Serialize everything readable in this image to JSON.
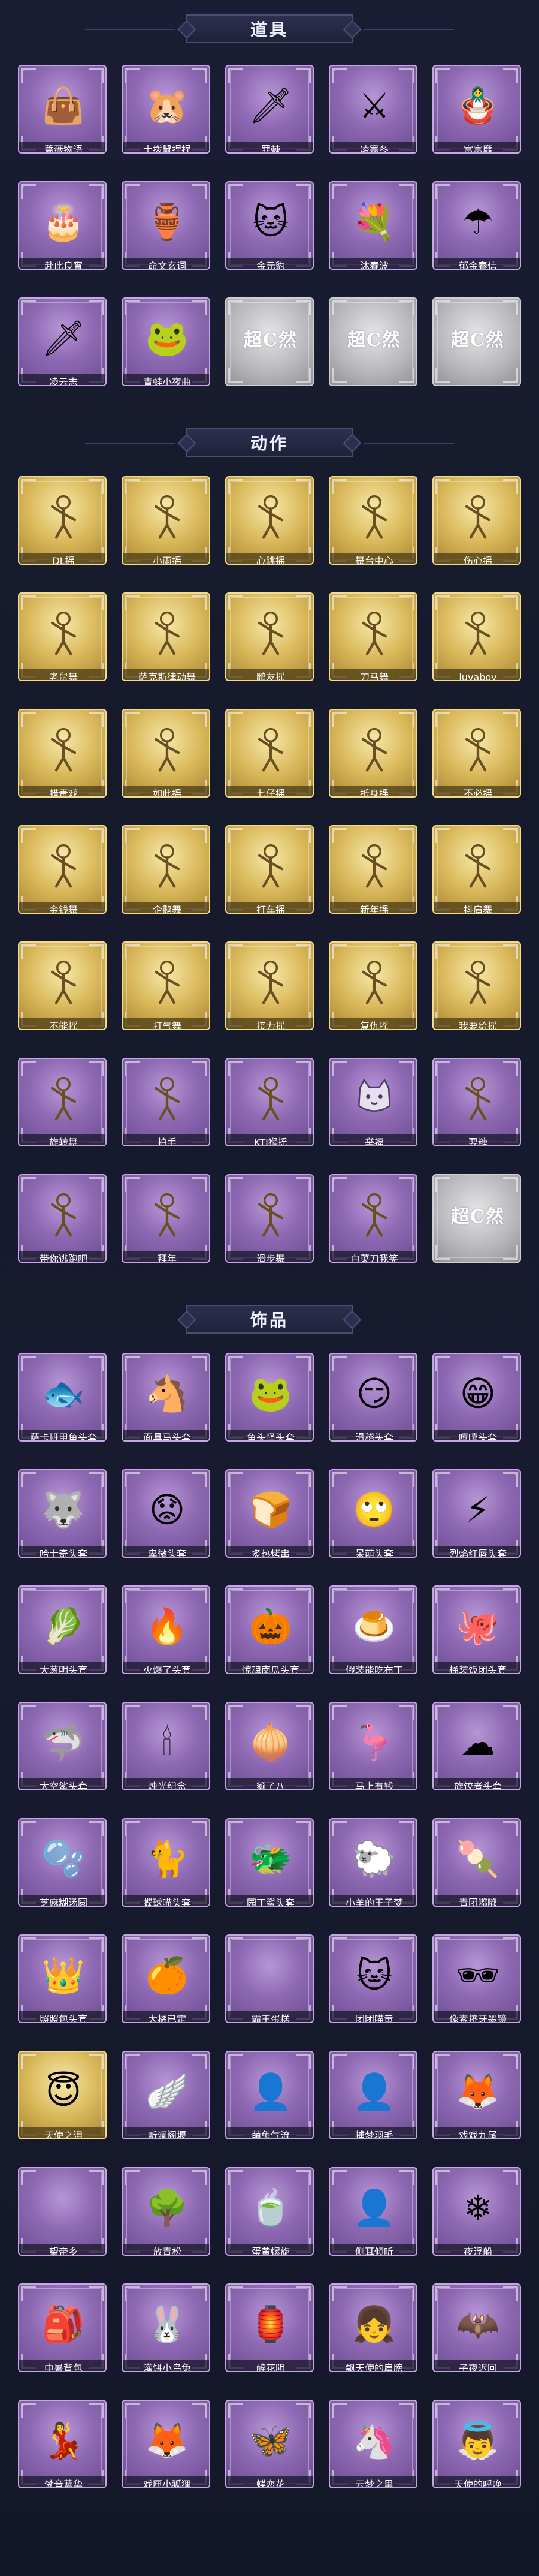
{
  "sections": [
    {
      "title": "道具",
      "items": [
        {
          "label": "蔷薇物语",
          "icon": "red-bag-icon",
          "glyph": "👜",
          "tier": "purple"
        },
        {
          "label": "土拨鼠捏捏",
          "icon": "groundhog-toy-icon",
          "glyph": "🐹",
          "tier": "purple"
        },
        {
          "label": "罪棘",
          "icon": "thorn-spear-icon",
          "glyph": "🗡",
          "tier": "purple"
        },
        {
          "label": "凌寒冬",
          "icon": "ice-sword-icon",
          "glyph": "⚔",
          "tier": "purple"
        },
        {
          "label": "富富靡",
          "icon": "pink-doll-icon",
          "glyph": "🪆",
          "tier": "purple"
        },
        {
          "label": "赴此良宵",
          "icon": "cake-icon",
          "glyph": "🎂",
          "tier": "purple"
        },
        {
          "label": "命文玄词",
          "icon": "jade-bottle-icon",
          "glyph": "🏺",
          "tier": "purple"
        },
        {
          "label": "金元豹",
          "icon": "lucky-cat-icon",
          "glyph": "🐱",
          "tier": "purple"
        },
        {
          "label": "沐春波",
          "icon": "flower-wreath-icon",
          "glyph": "💐",
          "tier": "purple"
        },
        {
          "label": "郁金春信",
          "icon": "paper-umbrella-icon",
          "glyph": "☂",
          "tier": "purple"
        },
        {
          "label": "凌云志",
          "icon": "blue-sword-icon",
          "glyph": "🗡",
          "tier": "purple"
        },
        {
          "label": "青蛙小夜曲",
          "icon": "frog-icon",
          "glyph": "🐸",
          "tier": "purple"
        },
        {
          "label": "",
          "icon": "placeholder-icon",
          "glyph": "超C然",
          "tier": "grey"
        },
        {
          "label": "",
          "icon": "placeholder-icon",
          "glyph": "超C然",
          "tier": "grey"
        },
        {
          "label": "",
          "icon": "placeholder-icon",
          "glyph": "超C然",
          "tier": "grey"
        }
      ]
    },
    {
      "title": "动作",
      "items": [
        {
          "label": "DL摇",
          "icon": "dance-pose-icon",
          "tier": "gold"
        },
        {
          "label": "小雨摇",
          "icon": "dance-pose-icon",
          "tier": "gold"
        },
        {
          "label": "心跳摇",
          "icon": "dance-pose-icon",
          "tier": "gold"
        },
        {
          "label": "舞台中心",
          "icon": "dance-pose-icon",
          "tier": "gold"
        },
        {
          "label": "伤心摇",
          "icon": "dance-pose-icon",
          "tier": "gold"
        },
        {
          "label": "老鼠舞",
          "icon": "dance-pose-icon",
          "tier": "gold"
        },
        {
          "label": "萨克斯律动舞",
          "icon": "dance-pose-icon",
          "tier": "gold"
        },
        {
          "label": "鹏友摇",
          "icon": "dance-pose-icon",
          "tier": "gold"
        },
        {
          "label": "刀马舞",
          "icon": "dance-pose-icon",
          "tier": "gold"
        },
        {
          "label": "luvaboy",
          "icon": "dance-pose-icon",
          "tier": "gold"
        },
        {
          "label": "蜡毒戏",
          "icon": "dance-pose-icon",
          "tier": "gold"
        },
        {
          "label": "如此摇",
          "icon": "dance-pose-icon",
          "tier": "gold"
        },
        {
          "label": "七仔摇",
          "icon": "dance-pose-icon",
          "tier": "gold"
        },
        {
          "label": "抵身摇",
          "icon": "dance-pose-icon",
          "tier": "gold"
        },
        {
          "label": "不必摇",
          "icon": "dance-pose-icon",
          "tier": "gold"
        },
        {
          "label": "金钱舞",
          "icon": "dance-pose-icon",
          "tier": "gold"
        },
        {
          "label": "企鹅舞",
          "icon": "dance-pose-icon",
          "tier": "gold"
        },
        {
          "label": "打车摇",
          "icon": "dance-pose-icon",
          "tier": "gold"
        },
        {
          "label": "新年摇",
          "icon": "dance-pose-icon",
          "tier": "gold"
        },
        {
          "label": "抖肩舞",
          "icon": "dance-pose-icon",
          "tier": "gold"
        },
        {
          "label": "不能摇",
          "icon": "dance-pose-icon",
          "tier": "gold"
        },
        {
          "label": "打气舞",
          "icon": "dance-pose-icon",
          "tier": "gold"
        },
        {
          "label": "接力摇",
          "icon": "dance-pose-icon",
          "tier": "gold"
        },
        {
          "label": "复仇摇",
          "icon": "dance-pose-icon",
          "tier": "gold"
        },
        {
          "label": "我要给摇",
          "icon": "dance-pose-icon",
          "tier": "gold"
        },
        {
          "label": "旋转舞",
          "icon": "dance-pose-icon",
          "tier": "purple"
        },
        {
          "label": "拍手",
          "icon": "dance-pose-icon",
          "tier": "purple"
        },
        {
          "label": "KTI猴摇",
          "icon": "dance-pose-icon",
          "tier": "purple"
        },
        {
          "label": "举福",
          "icon": "cat-face-icon",
          "tier": "purple"
        },
        {
          "label": "要糖",
          "icon": "dance-pose-icon",
          "tier": "purple"
        },
        {
          "label": "带你逃跑吧",
          "icon": "dance-pose-icon",
          "tier": "purple"
        },
        {
          "label": "拜年",
          "icon": "dance-pose-icon",
          "tier": "purple"
        },
        {
          "label": "滑步舞",
          "icon": "dance-pose-icon",
          "tier": "purple"
        },
        {
          "label": "白菜刀我笑",
          "icon": "dance-pose-icon",
          "tier": "purple"
        },
        {
          "label": "",
          "icon": "placeholder-icon",
          "glyph": "超C然",
          "tier": "grey"
        }
      ]
    },
    {
      "title": "饰品",
      "items": [
        {
          "label": "萨卡班甲鱼头套",
          "icon": "fish-head-icon",
          "glyph": "🐟",
          "tier": "purple"
        },
        {
          "label": "面具马头套",
          "icon": "horse-head-icon",
          "glyph": "🐴",
          "tier": "purple"
        },
        {
          "label": "鱼头怪头套",
          "icon": "fish-monster-icon",
          "glyph": "🐸",
          "tier": "purple"
        },
        {
          "label": "滑稽头套",
          "icon": "silly-face-icon",
          "glyph": "😏",
          "tier": "purple"
        },
        {
          "label": "嘻嘻头套",
          "icon": "grin-face-icon",
          "glyph": "😁",
          "tier": "purple"
        },
        {
          "label": "哈士奇头套",
          "icon": "husky-head-icon",
          "glyph": "🐺",
          "tier": "purple"
        },
        {
          "label": "卑微头套",
          "icon": "sad-face-icon",
          "glyph": "😟",
          "tier": "purple"
        },
        {
          "label": "炙热烤串",
          "icon": "toast-icon",
          "glyph": "🍞",
          "tier": "purple"
        },
        {
          "label": "呆萌头套",
          "icon": "silly-face-icon",
          "glyph": "🙄",
          "tier": "purple"
        },
        {
          "label": "烈焰红唇头套",
          "icon": "pikachu-head-icon",
          "glyph": "⚡",
          "tier": "purple"
        },
        {
          "label": "大葱明头套",
          "icon": "scallion-icon",
          "glyph": "🥬",
          "tier": "purple"
        },
        {
          "label": "火爆了头套",
          "icon": "fire-face-icon",
          "glyph": "🔥",
          "tier": "purple"
        },
        {
          "label": "惊魂南瓜头套",
          "icon": "pumpkin-icon",
          "glyph": "🎃",
          "tier": "purple"
        },
        {
          "label": "假装能吃布丁",
          "icon": "pudding-icon",
          "glyph": "🍮",
          "tier": "purple"
        },
        {
          "label": "桶装饭团头套",
          "icon": "pink-blob-icon",
          "glyph": "🐙",
          "tier": "purple"
        },
        {
          "label": "太空鲨头套",
          "icon": "shark-head-icon",
          "glyph": "🦈",
          "tier": "purple"
        },
        {
          "label": "烛光纪念",
          "icon": "candle-icon",
          "glyph": "🕯",
          "tier": "purple"
        },
        {
          "label": "额了八",
          "icon": "onion-icon",
          "glyph": "🧅",
          "tier": "purple"
        },
        {
          "label": "马上有钱",
          "icon": "flamingo-icon",
          "glyph": "🦩",
          "tier": "purple"
        },
        {
          "label": "旋饺者头套",
          "icon": "cloud-blob-icon",
          "glyph": "☁",
          "tier": "purple"
        },
        {
          "label": "芝麻糊汤圆",
          "icon": "blue-blob-icon",
          "glyph": "🫧",
          "tier": "purple"
        },
        {
          "label": "蝶球喵头套",
          "icon": "cat-head-icon",
          "glyph": "🐈",
          "tier": "purple"
        },
        {
          "label": "园丁鲨头套",
          "icon": "cute-dragon-icon",
          "glyph": "🐲",
          "tier": "purple"
        },
        {
          "label": "小羊的王子梦",
          "icon": "sheep-icon",
          "glyph": "🐑",
          "tier": "purple"
        },
        {
          "label": "青团嘟嘟",
          "icon": "green-bun-icon",
          "glyph": "🍡",
          "tier": "purple"
        },
        {
          "label": "照照包头套",
          "icon": "crown-bun-icon",
          "glyph": "👑",
          "tier": "purple"
        },
        {
          "label": "大橘已定",
          "icon": "orange-icon",
          "glyph": "🍊",
          "tier": "purple"
        },
        {
          "label": "霸王蛋糕",
          "icon": "empty-slot-icon",
          "glyph": "",
          "tier": "purple"
        },
        {
          "label": "团团喵黄",
          "icon": "yellow-cat-icon",
          "glyph": "🐱",
          "tier": "purple"
        },
        {
          "label": "像素挤牙墨镜",
          "icon": "sunglasses-icon",
          "glyph": "🕶",
          "tier": "purple"
        },
        {
          "label": "天使之泪",
          "icon": "angel-halo-icon",
          "glyph": "😇",
          "tier": "gold"
        },
        {
          "label": "听澜阁堰",
          "icon": "white-wings-icon",
          "glyph": "🪽",
          "tier": "purple"
        },
        {
          "label": "萌兔气流",
          "icon": "ghost-head-icon",
          "glyph": "👤",
          "tier": "purple"
        },
        {
          "label": "捕梦羽毛",
          "icon": "ghost-head-icon",
          "glyph": "👤",
          "tier": "purple"
        },
        {
          "label": "戏戏九尾",
          "icon": "nine-tail-icon",
          "glyph": "🦊",
          "tier": "purple"
        },
        {
          "label": "望帝乡",
          "icon": "empty-slot-icon",
          "glyph": "",
          "tier": "purple"
        },
        {
          "label": "放青松",
          "icon": "bonsai-icon",
          "glyph": "🌳",
          "tier": "purple"
        },
        {
          "label": "蛋黄螺旋",
          "icon": "cup-icon",
          "glyph": "🍵",
          "tier": "purple"
        },
        {
          "label": "侧耳倾听",
          "icon": "ghost-head-icon",
          "glyph": "👤",
          "tier": "purple"
        },
        {
          "label": "夜浮船",
          "icon": "crystal-icon",
          "glyph": "❄",
          "tier": "purple"
        },
        {
          "label": "中暑背包",
          "icon": "backpack-icon",
          "glyph": "🎒",
          "tier": "purple"
        },
        {
          "label": "灌饼小鸟兔",
          "icon": "blue-rabbit-icon",
          "glyph": "🐰",
          "tier": "purple"
        },
        {
          "label": "醉花阴",
          "icon": "headdress-icon",
          "glyph": "🏮",
          "tier": "purple"
        },
        {
          "label": "飘天使的肩膀",
          "icon": "angel-girl-icon",
          "glyph": "👧",
          "tier": "purple"
        },
        {
          "label": "子夜迟回",
          "icon": "black-wings-icon",
          "glyph": "🦇",
          "tier": "purple"
        },
        {
          "label": "梵音蓝华",
          "icon": "girl-figure-icon",
          "glyph": "💃",
          "tier": "purple"
        },
        {
          "label": "戏匣小狐狸",
          "icon": "fox-figure-icon",
          "glyph": "🦊",
          "tier": "purple"
        },
        {
          "label": "蝶恋花",
          "icon": "butterfly-icon",
          "glyph": "🦋",
          "tier": "purple"
        },
        {
          "label": "云梦之里",
          "icon": "unicorn-icon",
          "glyph": "🦄",
          "tier": "purple"
        },
        {
          "label": "天使的呼唤",
          "icon": "angel-figure-icon",
          "glyph": "👼",
          "tier": "purple"
        }
      ]
    }
  ]
}
